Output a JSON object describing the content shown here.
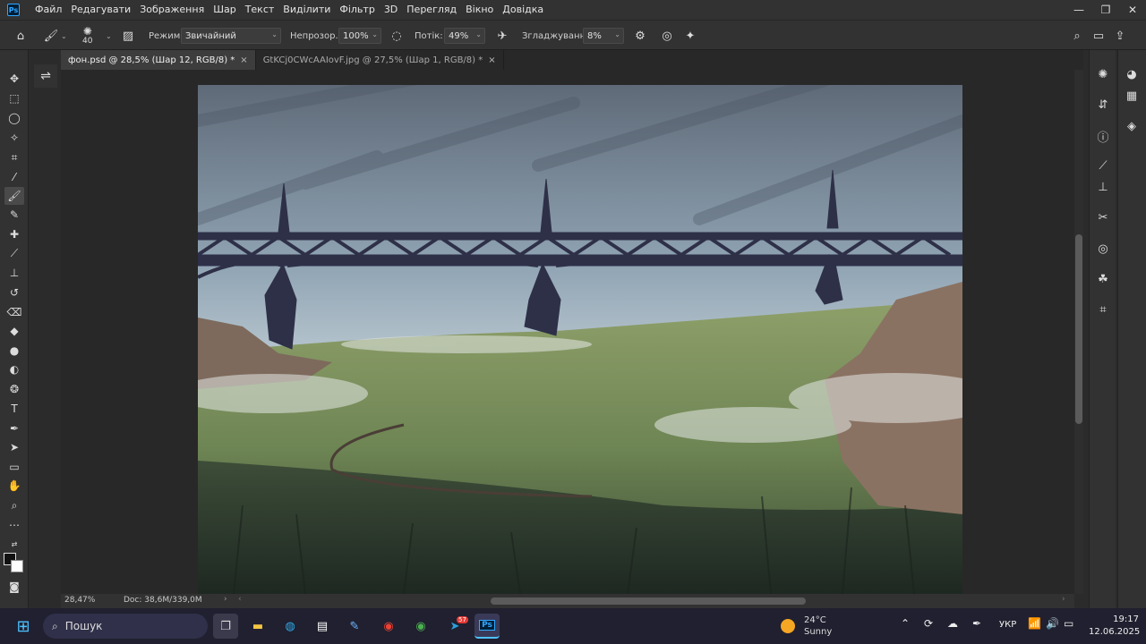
{
  "app": {
    "logo_text": "Ps"
  },
  "menu": [
    "Файл",
    "Редагувати",
    "Зображення",
    "Шар",
    "Текст",
    "Виділити",
    "Фільтр",
    "3D",
    "Перегляд",
    "Вікно",
    "Довідка"
  ],
  "options": {
    "brush_size": "40",
    "mode_label": "Режим:",
    "mode_value": "Звичайний",
    "opacity_label": "Непрозор.:",
    "opacity_value": "100%",
    "flow_label": "Потік:",
    "flow_value": "49%",
    "smoothing_label": "Згладжування:",
    "smoothing_value": "8%"
  },
  "tabs": [
    {
      "label": "фон.psd @ 28,5% (Шар 12, RGB/8) *",
      "active": true
    },
    {
      "label": "GtKCj0CWcAAIovF.jpg @ 27,5% (Шар 1, RGB/8) *",
      "active": false
    }
  ],
  "status": {
    "zoom": "28,47%",
    "doc": "Doc: 38,6M/339,0M"
  },
  "taskbar": {
    "search_placeholder": "Пошук",
    "weather_temp": "24°C",
    "weather_desc": "Sunny",
    "lang": "УКР",
    "time": "19:17",
    "date": "12.06.2025",
    "telegram_badge": "57"
  },
  "colors": {
    "accent": "#31a8ff",
    "fg_swatch": "#111111",
    "bg_swatch": "#ffffff"
  }
}
